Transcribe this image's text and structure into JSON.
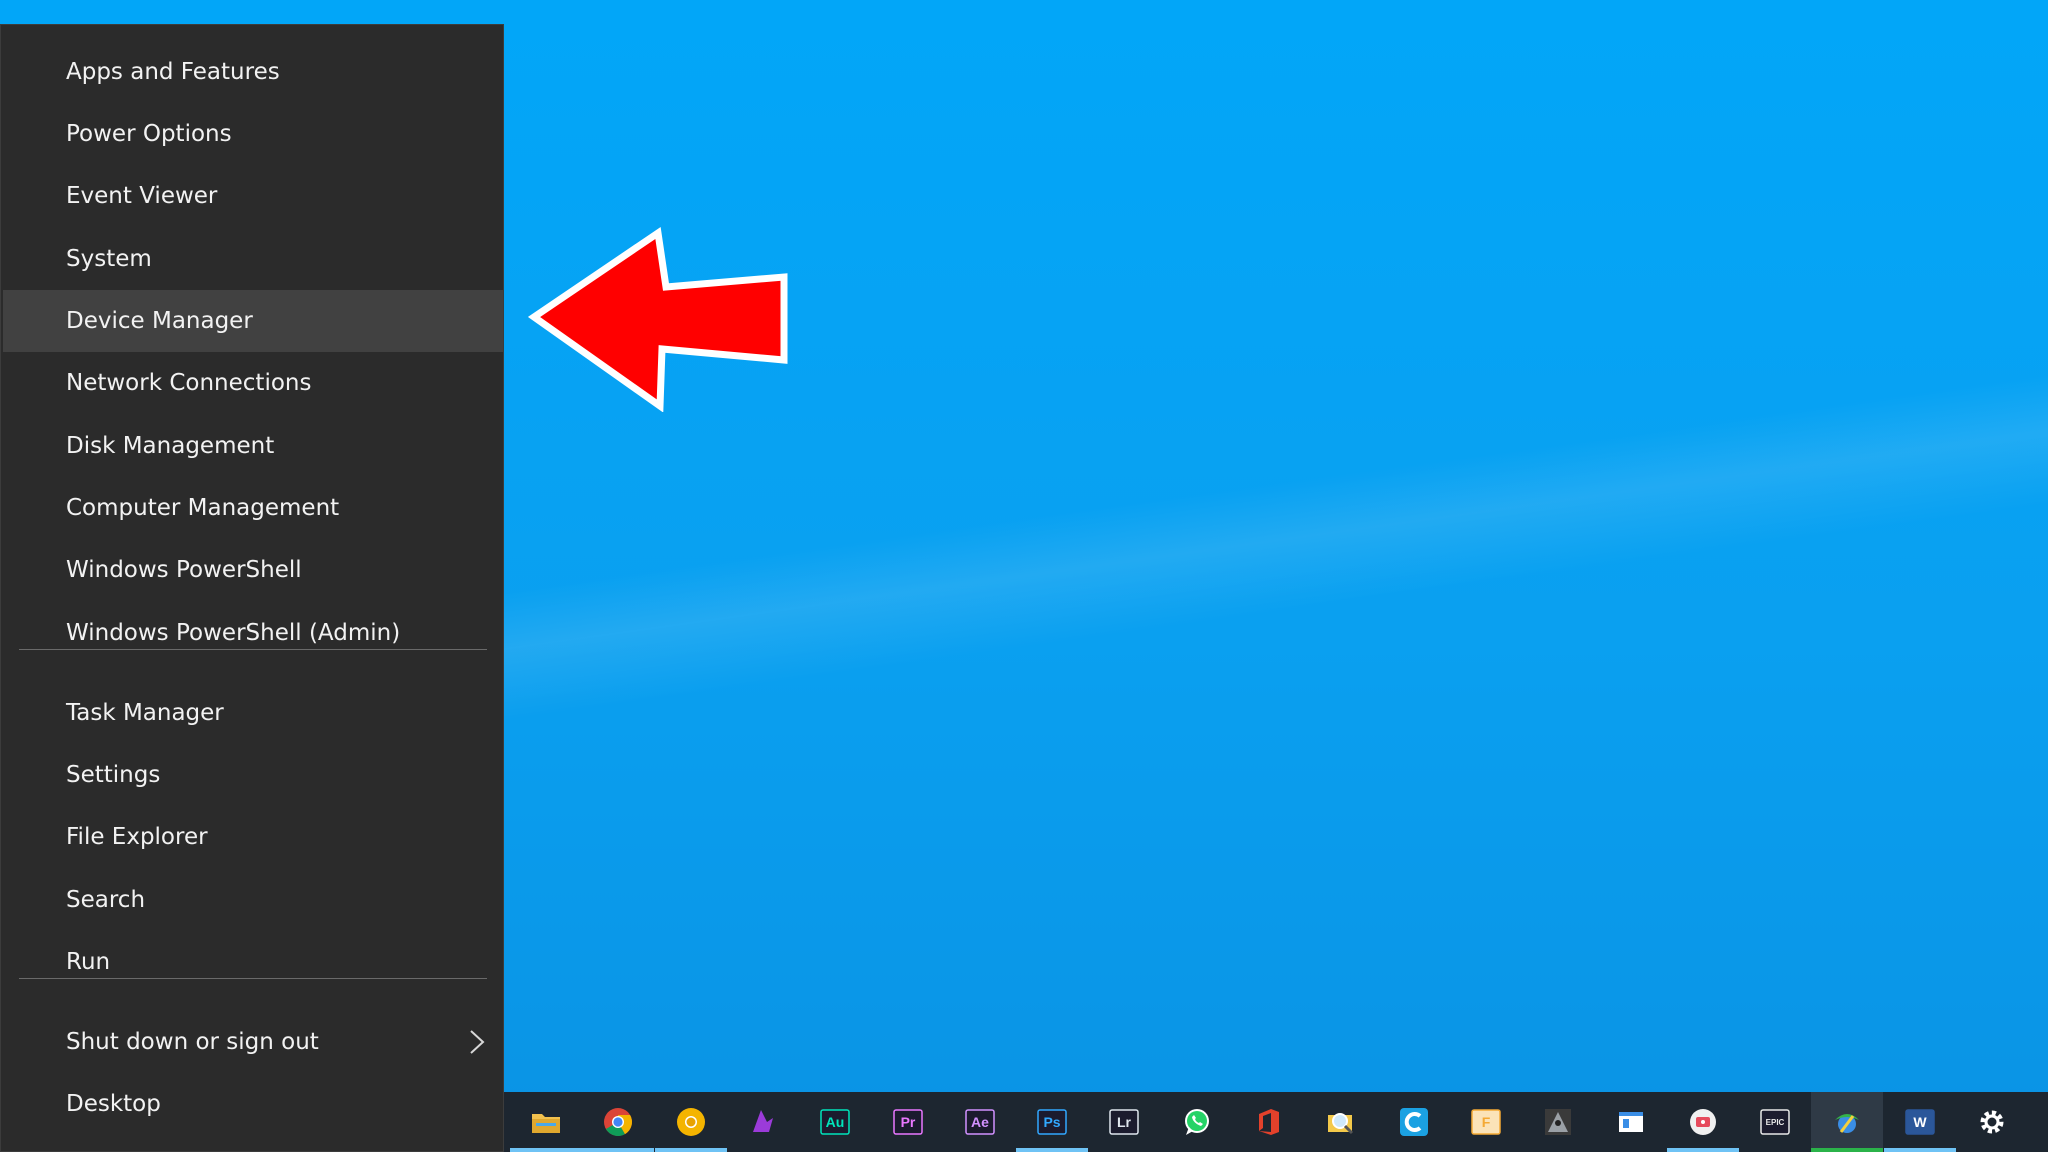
{
  "menu": {
    "items": [
      {
        "label": "Apps and Features"
      },
      {
        "label": "Power Options"
      },
      {
        "label": "Event Viewer"
      },
      {
        "label": "System"
      },
      {
        "label": "Device Manager",
        "selected": true
      },
      {
        "label": "Network Connections"
      },
      {
        "label": "Disk Management"
      },
      {
        "label": "Computer Management"
      },
      {
        "label": "Windows PowerShell"
      },
      {
        "label": "Windows PowerShell (Admin)"
      },
      {
        "label": "Task Manager"
      },
      {
        "label": "Settings"
      },
      {
        "label": "File Explorer"
      },
      {
        "label": "Search"
      },
      {
        "label": "Run"
      },
      {
        "label": "Shut down or sign out",
        "has_submenu": true
      },
      {
        "label": "Desktop"
      }
    ]
  },
  "taskbar": {
    "icons": [
      {
        "name": "file-explorer-icon",
        "text": "",
        "color": "#f2c14e",
        "running": true
      },
      {
        "name": "chrome-icon",
        "text": "",
        "color": "#4285f4",
        "running": true
      },
      {
        "name": "chrome-canary-icon",
        "text": "",
        "color": "#f4b400",
        "running": true
      },
      {
        "name": "app-purple-icon",
        "text": "",
        "color": "#9b3bd9",
        "running": false
      },
      {
        "name": "audition-icon",
        "text": "Au",
        "color": "#00e4bb",
        "running": false
      },
      {
        "name": "premiere-icon",
        "text": "Pr",
        "color": "#ea77ff",
        "running": false
      },
      {
        "name": "after-effects-icon",
        "text": "Ae",
        "color": "#d291ff",
        "running": false
      },
      {
        "name": "photoshop-icon",
        "text": "Ps",
        "color": "#31a8ff",
        "running": true
      },
      {
        "name": "lightroom-icon",
        "text": "Lr",
        "color": "#dfe6ee",
        "running": false
      },
      {
        "name": "whatsapp-icon",
        "text": "",
        "color": "#25d366",
        "running": false
      },
      {
        "name": "office-icon",
        "text": "",
        "color": "#e3412b",
        "running": false
      },
      {
        "name": "magnifier-folder-icon",
        "text": "",
        "color": "#f3c94a",
        "running": false
      },
      {
        "name": "ccleaner-icon",
        "text": "",
        "color": "#1ba1e2",
        "running": false
      },
      {
        "name": "app-f-icon",
        "text": "F",
        "color": "#f4a934",
        "running": false
      },
      {
        "name": "game-icon",
        "text": "",
        "color": "#9aa0a6",
        "running": false
      },
      {
        "name": "window-app-icon",
        "text": "",
        "color": "#3a8ee6",
        "running": false
      },
      {
        "name": "recorder-icon",
        "text": "",
        "color": "#e64a5c",
        "running": true
      },
      {
        "name": "epic-games-icon",
        "text": "EPIC",
        "color": "#e8e8e8",
        "running": false
      },
      {
        "name": "network-app-icon",
        "text": "",
        "color": "#34b34a",
        "running": true,
        "active": true
      },
      {
        "name": "word-icon",
        "text": "W",
        "color": "#2b579a",
        "running": true
      },
      {
        "name": "settings-gear-icon",
        "text": "",
        "color": "#ffffff",
        "running": false
      }
    ]
  }
}
